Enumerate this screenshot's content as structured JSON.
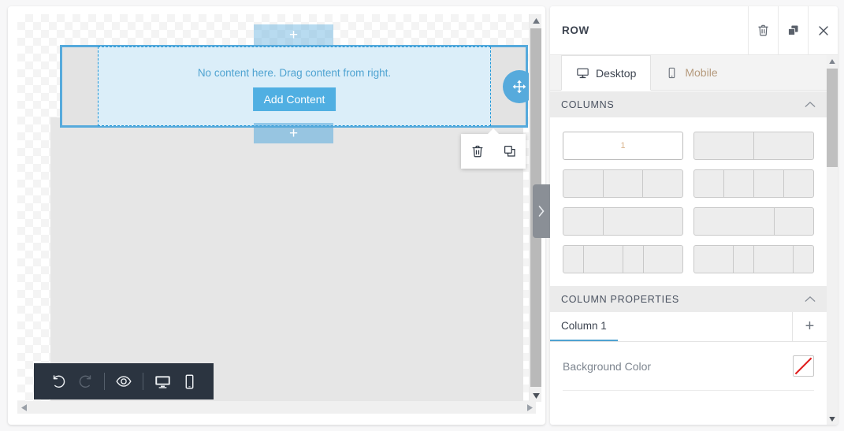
{
  "canvas": {
    "row": {
      "empty_text": "No content here. Drag content from right.",
      "add_content_label": "Add Content",
      "drag_handle_icon": "move-icon",
      "add_row_top_label": "+",
      "add_row_bottom_label": "+"
    },
    "row_actions": {
      "delete_icon": "trash-icon",
      "duplicate_icon": "copy-icon"
    },
    "scroll": {
      "up_arrow": "▲",
      "down_arrow": "▼",
      "left_arrow": "◀",
      "right_arrow": "▶"
    }
  },
  "bottom_toolbar": {
    "items": [
      {
        "name": "undo-button",
        "icon": "undo-icon",
        "enabled": true
      },
      {
        "name": "redo-button",
        "icon": "redo-icon",
        "enabled": false
      },
      {
        "name": "preview-button",
        "icon": "eye-icon",
        "enabled": true
      },
      {
        "name": "desktop-view-button",
        "icon": "desktop-icon",
        "enabled": true
      },
      {
        "name": "mobile-view-button",
        "icon": "mobile-icon",
        "enabled": true
      }
    ]
  },
  "panel_collapse": {
    "chevron": "›"
  },
  "panel": {
    "title": "ROW",
    "header_buttons": {
      "delete_icon": "trash-icon",
      "duplicate_icon": "copy-icon",
      "close_icon": "close-icon"
    },
    "device_tabs": [
      {
        "label": "Desktop",
        "icon": "desktop-icon",
        "active": true
      },
      {
        "label": "Mobile",
        "icon": "mobile-icon",
        "active": false
      }
    ],
    "columns_section": {
      "title": "COLUMNS",
      "collapse_icon": "chevron-up-icon",
      "layouts": [
        {
          "id": "l1",
          "cells": [
            100
          ],
          "label": "1",
          "selected": true
        },
        {
          "id": "l2",
          "cells": [
            50,
            50
          ],
          "selected": false
        },
        {
          "id": "l3",
          "cells": [
            33.33,
            33.33,
            33.34
          ],
          "selected": false
        },
        {
          "id": "l4",
          "cells": [
            25,
            25,
            25,
            25
          ],
          "selected": false
        },
        {
          "id": "l5",
          "cells": [
            33,
            67
          ],
          "selected": false
        },
        {
          "id": "l6",
          "cells": [
            67,
            33
          ],
          "selected": false
        },
        {
          "id": "l7",
          "cells": [
            17,
            33,
            17,
            33
          ],
          "selected": false
        },
        {
          "id": "l8",
          "cells": [
            33,
            17,
            33,
            17
          ],
          "selected": false
        }
      ]
    },
    "column_properties_section": {
      "title": "COLUMN PROPERTIES",
      "collapse_icon": "chevron-up-icon",
      "active_tab": "Column 1",
      "add_column_label": "+",
      "properties": [
        {
          "label": "Background Color",
          "value": "none",
          "swatch_color": "#ffffff",
          "none_stroke": "#e02020"
        }
      ]
    }
  },
  "colors": {
    "accent_blue": "#56aadc",
    "button_blue": "#50afe2",
    "row_fill": "#dbeef9",
    "toolbar_dark": "#2b3440"
  }
}
